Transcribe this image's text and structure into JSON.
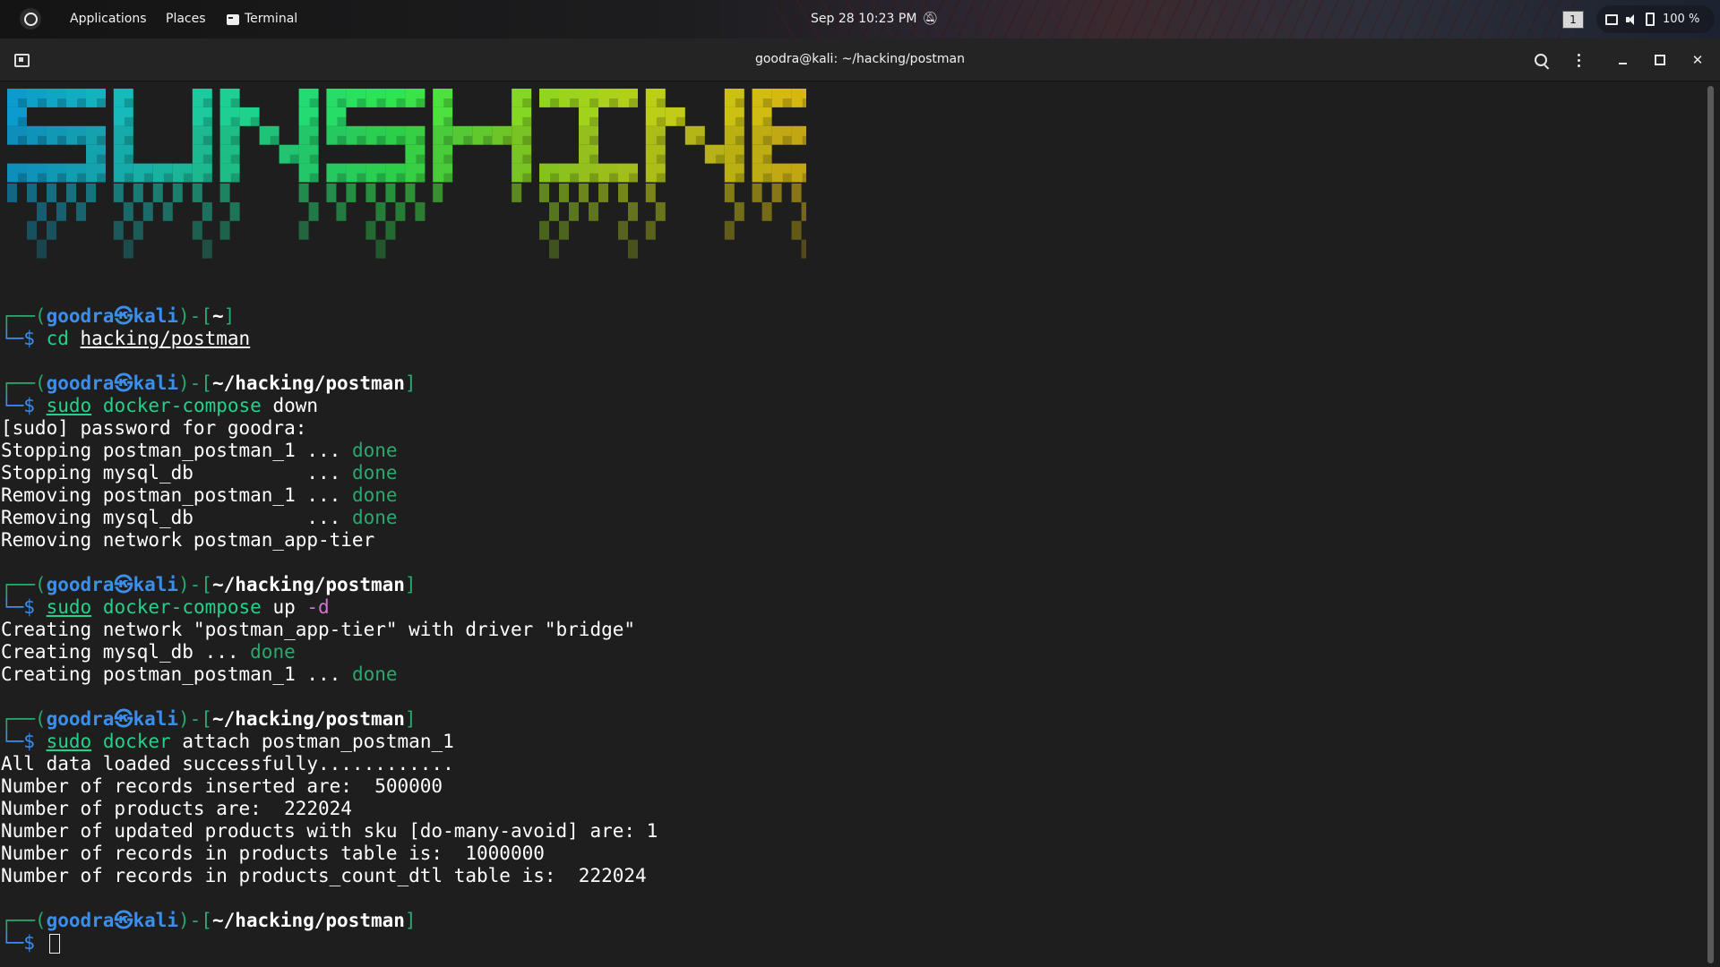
{
  "topbar": {
    "applications_label": "Applications",
    "places_label": "Places",
    "terminal_label": "Terminal",
    "clock": "Sep 28  10:23 PM",
    "workspace_number": "1",
    "battery_percent": "100 %",
    "icons": [
      "activities-icon",
      "terminal-icon",
      "bell-muted-icon",
      "display-icon",
      "volume-icon",
      "battery-icon"
    ]
  },
  "window": {
    "title": "goodra@kali: ~/hacking/postman",
    "icons": [
      "new-tab-icon",
      "search-icon",
      "menu-icon",
      "minimize-icon",
      "maximize-icon",
      "close-icon"
    ]
  },
  "banner": {
    "text": "SUNSHINE",
    "colors": [
      "#0aa0d8",
      "#18c8c0",
      "#20e088",
      "#30f050",
      "#90e020",
      "#c8d818",
      "#e0c010"
    ]
  },
  "prompt": {
    "open": "┌──(",
    "user": "goodra",
    "at_symbol": "㉿",
    "host": "kali",
    "mid": ")-[",
    "close": "]",
    "dollar": "└─$ "
  },
  "blocks": [
    {
      "dir": "~",
      "cmd": [
        {
          "t": "cd",
          "c": "g"
        },
        {
          "t": " ",
          "c": "w"
        },
        {
          "t": "hacking/postman",
          "c": "w u"
        }
      ],
      "output": []
    },
    {
      "dir": "~/hacking/postman",
      "cmd": [
        {
          "t": "sudo",
          "c": "g u"
        },
        {
          "t": " ",
          "c": "w"
        },
        {
          "t": "docker-compose",
          "c": "g"
        },
        {
          "t": " down",
          "c": "w"
        }
      ],
      "output": [
        [
          {
            "t": "[sudo] password for goodra:",
            "c": "w"
          }
        ],
        [
          {
            "t": "Stopping postman_postman_1 ... ",
            "c": "w"
          },
          {
            "t": "done",
            "c": "done"
          }
        ],
        [
          {
            "t": "Stopping mysql_db          ... ",
            "c": "w"
          },
          {
            "t": "done",
            "c": "done"
          }
        ],
        [
          {
            "t": "Removing postman_postman_1 ... ",
            "c": "w"
          },
          {
            "t": "done",
            "c": "done"
          }
        ],
        [
          {
            "t": "Removing mysql_db          ... ",
            "c": "w"
          },
          {
            "t": "done",
            "c": "done"
          }
        ],
        [
          {
            "t": "Removing network postman_app-tier",
            "c": "w"
          }
        ]
      ]
    },
    {
      "dir": "~/hacking/postman",
      "cmd": [
        {
          "t": "sudo",
          "c": "g u"
        },
        {
          "t": " ",
          "c": "w"
        },
        {
          "t": "docker-compose",
          "c": "g"
        },
        {
          "t": " up ",
          "c": "w"
        },
        {
          "t": "-d",
          "c": "m"
        }
      ],
      "output": [
        [
          {
            "t": "Creating network \"postman_app-tier\" with driver \"bridge\"",
            "c": "w"
          }
        ],
        [
          {
            "t": "Creating mysql_db ... ",
            "c": "w"
          },
          {
            "t": "done",
            "c": "done"
          }
        ],
        [
          {
            "t": "Creating postman_postman_1 ... ",
            "c": "w"
          },
          {
            "t": "done",
            "c": "done"
          }
        ]
      ]
    },
    {
      "dir": "~/hacking/postman",
      "cmd": [
        {
          "t": "sudo",
          "c": "g u"
        },
        {
          "t": " ",
          "c": "w"
        },
        {
          "t": "docker",
          "c": "g"
        },
        {
          "t": " attach postman_postman_1",
          "c": "w"
        }
      ],
      "output": [
        [
          {
            "t": "All data loaded successfully............",
            "c": "w"
          }
        ],
        [
          {
            "t": "Number of records inserted are:  500000",
            "c": "w"
          }
        ],
        [
          {
            "t": "Number of products are:  222024",
            "c": "w"
          }
        ],
        [
          {
            "t": "Number of updated products with sku [do-many-avoid] are: 1",
            "c": "w"
          }
        ],
        [
          {
            "t": "Number of records in products table is:  1000000",
            "c": "w"
          }
        ],
        [
          {
            "t": "Number of records in products_count_dtl table is:  222024",
            "c": "w"
          }
        ]
      ]
    },
    {
      "dir": "~/hacking/postman",
      "cmd": [],
      "output": [],
      "cursor": true
    }
  ]
}
